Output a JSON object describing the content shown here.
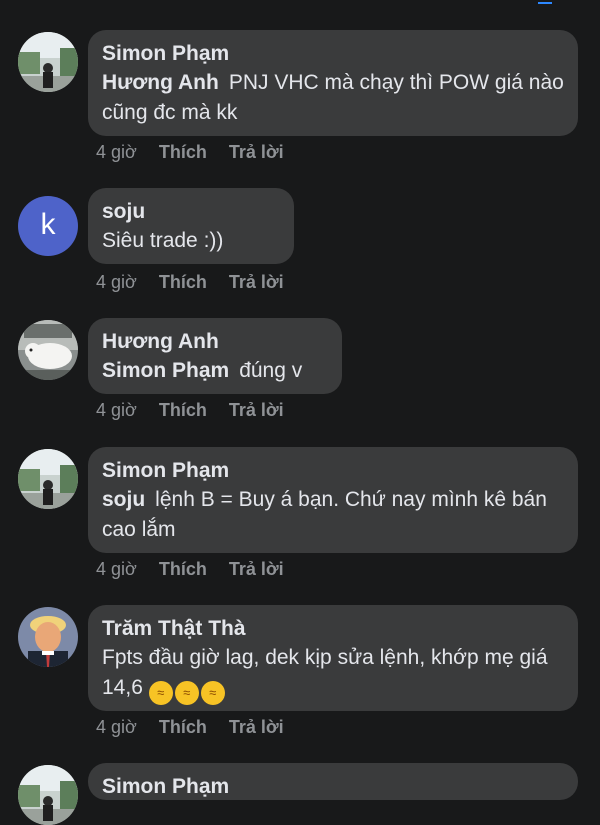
{
  "comments": [
    {
      "author": "Simon Phạm",
      "mention": "Hương Anh",
      "text": "PNJ VHC mà chạy thì POW giá nào cũng đc mà kk",
      "time": "4 giờ",
      "like": "Thích",
      "reply": "Trả lời",
      "avatar": "photo-street-icon"
    },
    {
      "author": "soju",
      "mention": "",
      "text": "Siêu trade :))",
      "time": "4 giờ",
      "like": "Thích",
      "reply": "Trả lời",
      "avatar_letter": "k"
    },
    {
      "author": "Hương Anh",
      "mention": "Simon Phạm",
      "text": "đúng v",
      "time": "4 giờ",
      "like": "Thích",
      "reply": "Trả lời",
      "avatar": "photo-dog-icon"
    },
    {
      "author": "Simon Phạm",
      "mention": "soju",
      "text": "lệnh B = Buy á bạn. Chứ nay mình kê bán cao lắm",
      "time": "4 giờ",
      "like": "Thích",
      "reply": "Trả lời",
      "avatar": "photo-street-icon"
    },
    {
      "author": "Trăm Thật Thà",
      "mention": "",
      "text": "Fpts đầu giờ lag, dek kịp sửa lệnh, khớp mẹ giá 14,6",
      "emoji": "🤣🤣🤣",
      "time": "4 giờ",
      "like": "Thích",
      "reply": "Trả lời",
      "avatar": "photo-portrait-icon"
    },
    {
      "author": "Simon Phạm",
      "avatar": "photo-street-icon"
    }
  ],
  "colors": {
    "background": "#18191a",
    "bubble": "#3a3b3c",
    "text": "#e4e6eb",
    "meta": "#8f9296",
    "avatar_letter_bg": "#4e63c9"
  }
}
